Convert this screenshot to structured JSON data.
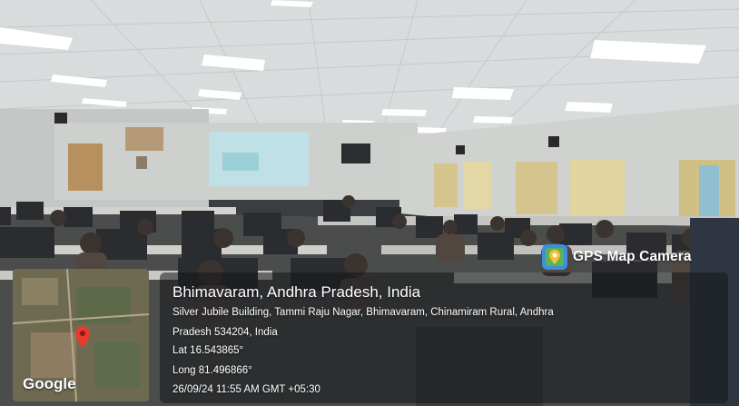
{
  "photo": {
    "subject": "computer-lab-classroom",
    "palette": {
      "ceiling": "#d9dcdc",
      "wall": "#c9ccca",
      "floor": "#4b4d4c",
      "projector_screen": "#bfe0e6",
      "monitor": "#2a2c30",
      "curtain": "#d6c48e",
      "door": "#b89060"
    }
  },
  "gps_badge": {
    "icon": "map-pin-icon",
    "label": "GPS Map Camera"
  },
  "map_thumbnail": {
    "icon": "map-pin-icon",
    "attribution": "Google"
  },
  "location": {
    "city_line": "Bhimavaram, Andhra Pradesh, India",
    "address_line_1": "Silver Jubile Building, Tammi Raju Nagar, Bhimavaram, Chinamiram Rural, Andhra",
    "address_line_2": "Pradesh 534204, India",
    "latitude": "Lat 16.543865°",
    "longitude": "Long 81.496866°",
    "datetime": "26/09/24 11:55 AM GMT +05:30"
  }
}
